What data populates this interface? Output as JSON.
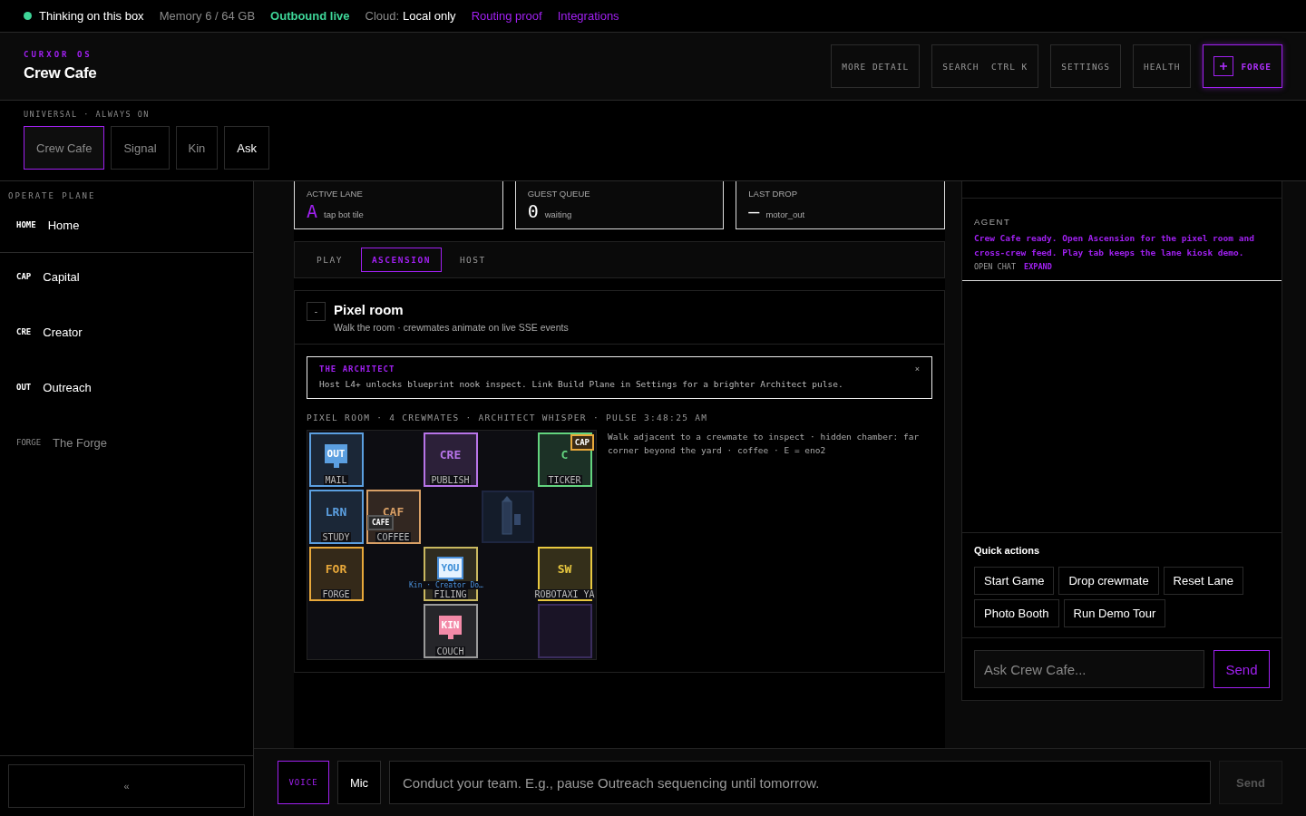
{
  "status_bar": {
    "indicator": "Thinking on this box",
    "memory": "Memory 6 / 64 GB",
    "outbound": "Outbound live",
    "cloud_label": "Cloud:",
    "cloud_value": "Local only",
    "links": [
      "Routing proof",
      "Integrations"
    ]
  },
  "header": {
    "brand": "CURXOR OS",
    "title": "Crew Cafe",
    "buttons": [
      {
        "label": "MORE DETAIL",
        "kind": "plain"
      },
      {
        "label": "SEARCH  CTRL K",
        "kind": "plain"
      },
      {
        "label": "SETTINGS",
        "kind": "plain"
      },
      {
        "label": "HEALTH",
        "kind": "plain"
      },
      {
        "label": "FORGE",
        "kind": "primary"
      }
    ]
  },
  "universal": {
    "label": "UNIVERSAL · ALWAYS ON",
    "tabs": [
      {
        "label": "Crew Cafe",
        "selected": true
      },
      {
        "label": "Signal",
        "selected": false
      },
      {
        "label": "Kin",
        "selected": false
      },
      {
        "label": "Ask",
        "selected": false
      }
    ]
  },
  "sidebar": {
    "heading": "OPERATE PLANE",
    "home": {
      "code": "HOME",
      "label": "Home",
      "muted": false
    },
    "items": [
      {
        "code": "CAP",
        "label": "Capital",
        "muted": false
      },
      {
        "code": "CRE",
        "label": "Creator",
        "muted": false
      },
      {
        "code": "OUT",
        "label": "Outreach",
        "muted": false
      },
      {
        "code": "FORGE",
        "label": "The Forge",
        "muted": true
      }
    ],
    "collapse": "«"
  },
  "stats": [
    {
      "label": "ACTIVE LANE",
      "value": "A",
      "caption": "tap bot tile",
      "kind": "accent"
    },
    {
      "label": "GUEST QUEUE",
      "value": "0",
      "caption": "waiting",
      "kind": "plain"
    },
    {
      "label": "LAST DROP",
      "value": "—",
      "caption": "motor_out",
      "kind": "plain"
    }
  ],
  "mode_tabs": [
    {
      "label": "PLAY",
      "selected": false
    },
    {
      "label": "ASCENSION",
      "selected": true
    },
    {
      "label": "HOST",
      "selected": false
    }
  ],
  "pixel_room": {
    "toggle": "-",
    "title": "Pixel room",
    "subtitle": "Walk the room · crewmates animate on live SSE events",
    "notice": {
      "title": "THE ARCHITECT",
      "text": "Host L4+ unlocks blueprint nook inspect. Link Build Plane in Settings for a brighter Architect pulse.",
      "close": "×"
    },
    "meta": "PIXEL ROOM · 4 CREWMATES · ARCHITECT WHISPER · PULSE 3:48:25 AM",
    "hint": "Walk adjacent to a crewmate to inspect · hidden chamber: far corner beyond the yard · coffee · E = eno2",
    "cells": [
      {
        "kind": "room",
        "label": "MAIL",
        "color": "#5b9fe0",
        "avatar": "OUT"
      },
      {
        "kind": "empty"
      },
      {
        "kind": "room",
        "code": "CRE",
        "label": "PUBLISH",
        "color": "#b774e8"
      },
      {
        "kind": "empty"
      },
      {
        "kind": "room",
        "code": "C",
        "label": "TICKER",
        "color": "#63d47f",
        "badge": "CAP"
      },
      {
        "kind": "room",
        "code": "LRN",
        "label": "STUDY",
        "color": "#5b9fe0"
      },
      {
        "kind": "room",
        "code": "CAF",
        "label": "COFFEE",
        "color": "#d9a066",
        "badge": "CAFE"
      },
      {
        "kind": "empty"
      },
      {
        "kind": "lighthouse"
      },
      {
        "kind": "empty"
      },
      {
        "kind": "room",
        "code": "FOR",
        "label": "FORGE",
        "color": "#e8a83a"
      },
      {
        "kind": "empty"
      },
      {
        "kind": "room",
        "label": "FILING",
        "color": "#c9b860",
        "avatar": "YOU",
        "caption": "Kin · Creator Do…"
      },
      {
        "kind": "empty"
      },
      {
        "kind": "room",
        "code": "SW",
        "label": "ROBOTAXI YA",
        "color": "#e8c840"
      },
      {
        "kind": "empty"
      },
      {
        "kind": "empty"
      },
      {
        "kind": "room",
        "label": "COUCH",
        "color": "#9a9a9a",
        "avatar": "KIN"
      },
      {
        "kind": "empty"
      },
      {
        "kind": "vacant",
        "color": "#3b2d5e"
      }
    ]
  },
  "agent": {
    "label": "AGENT",
    "message": "Crew Cafe ready. Open Ascension for the pixel room and cross-crew feed. Play tab keeps the lane kiosk demo.",
    "links": [
      {
        "label": "OPEN CHAT",
        "kind": "plain"
      },
      {
        "label": "EXPAND",
        "kind": "accent"
      }
    ]
  },
  "quick_actions": {
    "title": "Quick actions",
    "buttons": [
      "Start Game",
      "Drop crewmate",
      "Reset Lane",
      "Photo Booth",
      "Run Demo Tour"
    ]
  },
  "ask": {
    "placeholder": "Ask Crew Cafe...",
    "send": "Send"
  },
  "command_bar": {
    "voice": "VOICE",
    "mic": "Mic",
    "placeholder": "Conduct your team. E.g., pause Outreach sequencing until tomorrow.",
    "send": "Send",
    "send_disabled": true
  }
}
